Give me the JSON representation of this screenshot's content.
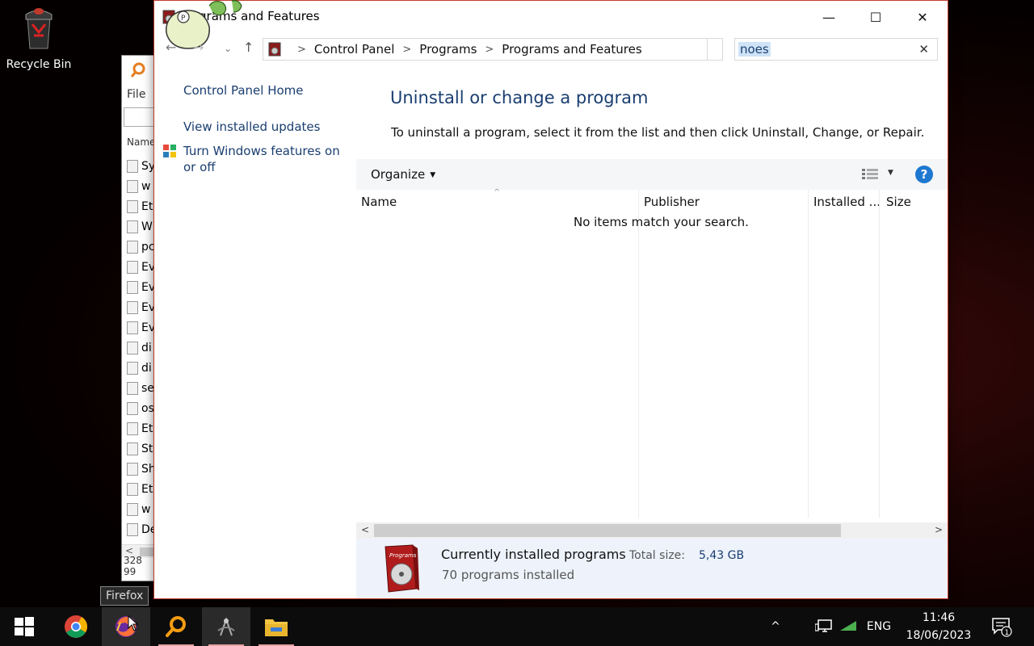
{
  "desktop": {
    "recycle_bin_label": "Recycle Bin"
  },
  "background_window": {
    "menu_file": "File",
    "column_name": "Name",
    "file_rows": [
      "Sy",
      "w",
      "Et",
      "W",
      "pc",
      "Ev",
      "Ev",
      "Ev",
      "Ev",
      "di",
      "di",
      "se",
      "os",
      "Et",
      "St",
      "Sh",
      "Et",
      "w",
      "De"
    ],
    "scroll_left": "<",
    "status": "328 99"
  },
  "window": {
    "title": "Programs and Features",
    "title_visible": "rograms and Features",
    "buttons": {
      "minimize": "—",
      "maximize": "☐",
      "close": "✕"
    },
    "nav": {
      "back": "←",
      "forward": "→",
      "recent": "⌄",
      "up": "↑"
    },
    "breadcrumb": [
      "Control Panel",
      "Programs",
      "Programs and Features"
    ],
    "breadcrumb_separator": ">",
    "search": {
      "query": "noes",
      "clear": "✕"
    }
  },
  "left_pane": {
    "home": "Control Panel Home",
    "updates": "View installed updates",
    "features": "Turn Windows features on or off"
  },
  "content": {
    "heading": "Uninstall or change a program",
    "description": "To uninstall a program, select it from the list and then click Uninstall, Change, or Repair.",
    "toolbar": {
      "organize": "Organize",
      "organize_caret": "▼",
      "view_caret": "▼",
      "help": "?"
    },
    "columns": [
      "Name",
      "Publisher",
      "Installed ...",
      "Size"
    ],
    "sort_indicator": "^",
    "empty_message": "No items match your search.",
    "scroll": {
      "left": "<",
      "right": ">"
    }
  },
  "details": {
    "box_label": "Programs",
    "title": "Currently installed programs",
    "size_label": "Total size:",
    "size_value": "5,43 GB",
    "count": "70 programs installed"
  },
  "tooltip": "Firefox",
  "taskbar": {
    "tray_chevron": "^",
    "language": "ENG",
    "time": "11:46",
    "date": "18/06/2023",
    "notification_count": "1"
  },
  "colors": {
    "accent": "#1a3e70",
    "help_blue": "#1e78d0",
    "window_border": "#c0392b",
    "details_bg": "#eef3fb"
  }
}
